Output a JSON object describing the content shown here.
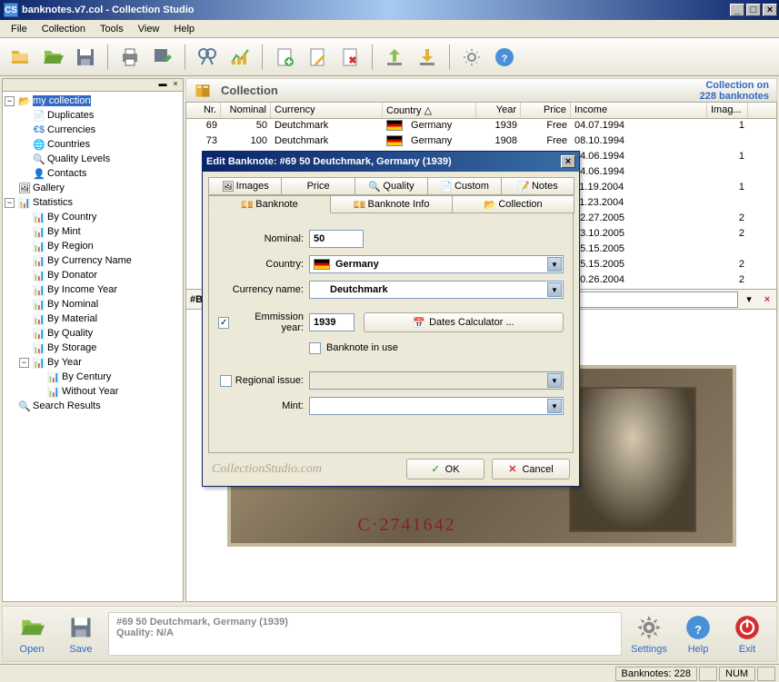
{
  "titlebar": {
    "filename": "banknotes.v7.col",
    "app": "Collection Studio"
  },
  "menu": {
    "file": "File",
    "collection": "Collection",
    "tools": "Tools",
    "view": "View",
    "help": "Help"
  },
  "tree": {
    "root": "my collection",
    "duplicates": "Duplicates",
    "currencies": "Currencies",
    "countries": "Countries",
    "quality": "Quality Levels",
    "contacts": "Contacts",
    "gallery": "Gallery",
    "statistics": "Statistics",
    "by_country": "By Country",
    "by_mint": "By Mint",
    "by_region": "By Region",
    "by_currency_name": "By Currency Name",
    "by_donator": "By Donator",
    "by_income_year": "By Income Year",
    "by_nominal": "By Nominal",
    "by_material": "By Material",
    "by_quality": "By Quality",
    "by_storage": "By Storage",
    "by_year": "By Year",
    "by_century": "By Century",
    "without_year": "Without Year",
    "search_results": "Search Results"
  },
  "header": {
    "title": "Collection",
    "info1": "Collection on",
    "info2": "228 banknotes"
  },
  "grid": {
    "cols": {
      "nr": "Nr.",
      "nominal": "Nominal",
      "currency": "Currency",
      "country": "Country △",
      "year": "Year",
      "price": "Price",
      "income": "Income",
      "imag": "Imag..."
    },
    "rows": [
      {
        "nr": "69",
        "nominal": "50",
        "currency": "Deutchmark",
        "country": "Germany",
        "year": "1939",
        "price": "Free",
        "income": "04.07.1994",
        "img": "1"
      },
      {
        "nr": "73",
        "nominal": "100",
        "currency": "Deutchmark",
        "country": "Germany",
        "year": "1908",
        "price": "Free",
        "income": "08.10.1994",
        "img": ""
      },
      {
        "income": "04.06.1994",
        "img": "1"
      },
      {
        "income": "04.06.1994",
        "img": ""
      },
      {
        "income": "11.19.2004",
        "img": "1"
      },
      {
        "income": "11.23.2004",
        "img": ""
      },
      {
        "income": "02.27.2005",
        "img": "2"
      },
      {
        "income": "03.10.2005",
        "img": "2"
      },
      {
        "income": "05.15.2005",
        "img": ""
      },
      {
        "income": "05.15.2005",
        "img": "2"
      },
      {
        "income": "10.26.2004",
        "img": "2"
      }
    ],
    "filter_prefix": "#В"
  },
  "dialog": {
    "title": "Edit Banknote: #69 50 Deutchmark, Germany (1939)",
    "tabs": {
      "images": "Images",
      "price": "Price",
      "quality": "Quality",
      "custom": "Custom",
      "notes": "Notes",
      "banknote": "Banknote",
      "banknote_info": "Banknote Info",
      "collection": "Collection"
    },
    "labels": {
      "nominal": "Nominal:",
      "country": "Country:",
      "currency_name": "Currency name:",
      "emission_year": "Emmission year:",
      "banknote_in_use": "Banknote in use",
      "regional_issue": "Regional issue:",
      "mint": "Mint:",
      "dates_calc": "Dates Calculator ..."
    },
    "values": {
      "nominal": "50",
      "country": "Germany",
      "currency_name": "Deutchmark",
      "emission_year": "1939",
      "regional_issue": "",
      "mint": ""
    },
    "watermark": "CollectionStudio.com",
    "ok": "OK",
    "cancel": "Cancel"
  },
  "bottom": {
    "open": "Open",
    "save": "Save",
    "info1": "#69 50 Deutchmark, Germany (1939)",
    "info2": "Quality: N/A",
    "settings": "Settings",
    "help": "Help",
    "exit": "Exit"
  },
  "status": {
    "banknotes": "Banknotes: 228",
    "num": "NUM"
  }
}
